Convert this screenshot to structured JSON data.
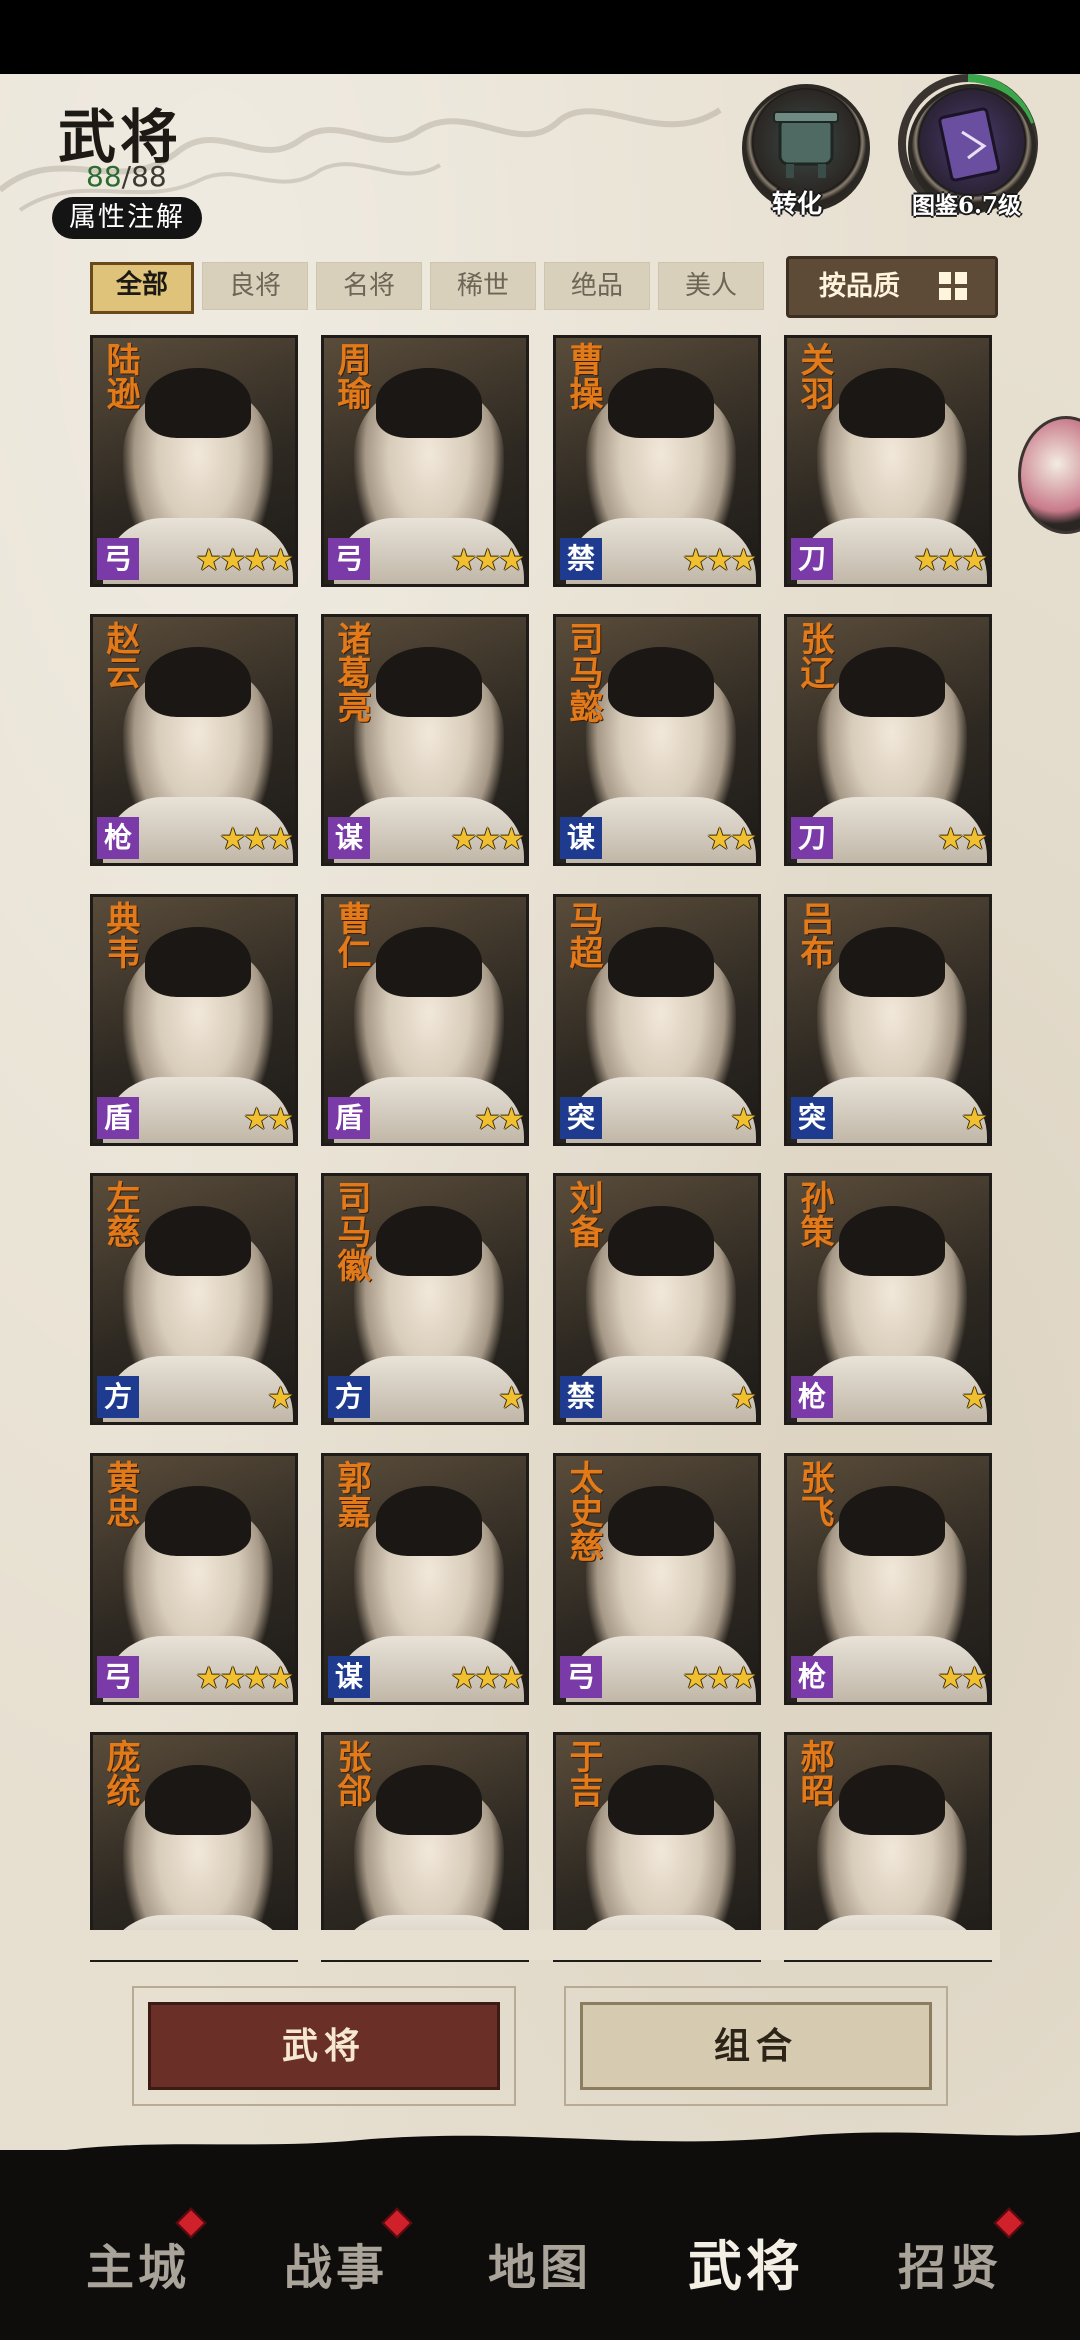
{
  "header": {
    "title": "武将",
    "count_current": "88",
    "count_total": "/88",
    "attr_button": "属性注解",
    "convert_label": "转化",
    "codex_label": "图鉴6.7级"
  },
  "filters": {
    "tabs": [
      "全部",
      "良将",
      "名将",
      "稀世",
      "绝品",
      "美人"
    ],
    "active_index": 0,
    "sort_label": "按品质"
  },
  "cards": [
    {
      "name": "陆逊",
      "type": "弓",
      "stars": "★★★★",
      "type_color": "purple"
    },
    {
      "name": "周瑜",
      "type": "弓",
      "stars": "★★★",
      "type_color": "purple"
    },
    {
      "name": "曹操",
      "type": "禁",
      "stars": "★★★",
      "type_color": "blue"
    },
    {
      "name": "关羽",
      "type": "刀",
      "stars": "★★★",
      "type_color": "purple"
    },
    {
      "name": "赵云",
      "type": "枪",
      "stars": "★★★",
      "type_color": "purple"
    },
    {
      "name": "诸葛亮",
      "type": "谋",
      "stars": "★★★",
      "type_color": "purple"
    },
    {
      "name": "司马懿",
      "type": "谋",
      "stars": "★★",
      "type_color": "blue"
    },
    {
      "name": "张辽",
      "type": "刀",
      "stars": "★★",
      "type_color": "purple"
    },
    {
      "name": "典韦",
      "type": "盾",
      "stars": "★★",
      "type_color": "purple"
    },
    {
      "name": "曹仁",
      "type": "盾",
      "stars": "★★",
      "type_color": "purple"
    },
    {
      "name": "马超",
      "type": "突",
      "stars": "★",
      "type_color": "blue"
    },
    {
      "name": "吕布",
      "type": "突",
      "stars": "★",
      "type_color": "blue"
    },
    {
      "name": "左慈",
      "type": "方",
      "stars": "★",
      "type_color": "blue"
    },
    {
      "name": "司马徽",
      "type": "方",
      "stars": "★",
      "type_color": "blue"
    },
    {
      "name": "刘备",
      "type": "禁",
      "stars": "★",
      "type_color": "blue"
    },
    {
      "name": "孙策",
      "type": "枪",
      "stars": "★",
      "type_color": "purple"
    },
    {
      "name": "黄忠",
      "type": "弓",
      "stars": "★★★★",
      "type_color": "purple"
    },
    {
      "name": "郭嘉",
      "type": "谋",
      "stars": "★★★",
      "type_color": "blue"
    },
    {
      "name": "太史慈",
      "type": "弓",
      "stars": "★★★",
      "type_color": "purple"
    },
    {
      "name": "张飞",
      "type": "枪",
      "stars": "★★",
      "type_color": "purple"
    },
    {
      "name": "庞统",
      "type": "",
      "stars": "",
      "type_color": "blue"
    },
    {
      "name": "张郃",
      "type": "",
      "stars": "",
      "type_color": "purple"
    },
    {
      "name": "于吉",
      "type": "",
      "stars": "",
      "type_color": "blue"
    },
    {
      "name": "郝昭",
      "type": "",
      "stars": "",
      "type_color": "purple"
    }
  ],
  "bottom_buttons": {
    "generals": "武将",
    "combination": "组合"
  },
  "nav": {
    "items": [
      "主城",
      "战事",
      "地图",
      "武将",
      "招贤"
    ],
    "active_index": 3
  },
  "colors": {
    "accent_orange": "#e37a1a",
    "type_purple": "#7a3aa7",
    "type_blue": "#1e3b8f",
    "star_gold": "#f0c030"
  }
}
